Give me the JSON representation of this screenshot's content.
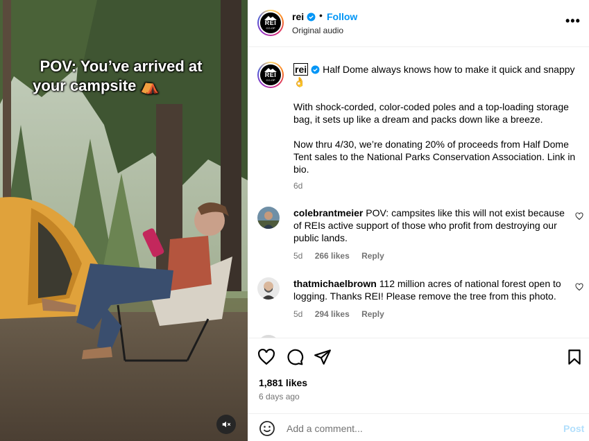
{
  "video": {
    "overlay_line1": "POV: You’ve arrived at",
    "overlay_line2": "your campsite ⛺",
    "mute_icon": "speaker-muted-icon"
  },
  "header": {
    "username": "rei",
    "separator": "•",
    "follow_label": "Follow",
    "audio_label": "Original audio",
    "more_label": "•••",
    "logo_text": "REI",
    "logo_subtext": "CO-OP"
  },
  "caption": {
    "username": "rei",
    "line1": "Half Dome always knows how to make it quick and snappy 👌",
    "para2": "With shock-corded, color-coded poles and a top-loading storage bag, it sets up like a dream and packs down like a breeze.",
    "para3": "Now thru 4/30, we’re donating 20% of proceeds from Half Dome Tent sales to the National Parks Conservation Association. Link in bio.",
    "time": "6d"
  },
  "comments": [
    {
      "username": "colebrantmeier",
      "text": "POV: campsites like this will not exist because of REIs active support of those who profit from destroying our public lands.",
      "time": "5d",
      "likes": "266 likes",
      "reply": "Reply"
    },
    {
      "username": "thatmichaelbrown",
      "text": "112 million acres of national forest open to logging. Thanks REI! Please remove the tree from this photo.",
      "time": "5d",
      "likes": "294 likes",
      "reply": "Reply"
    }
  ],
  "actions": {
    "likes": "1,881 likes",
    "posted": "6 days ago"
  },
  "add_comment": {
    "placeholder": "Add a comment...",
    "post_label": "Post"
  },
  "colors": {
    "follow": "#0095f6",
    "post_disabled": "#b2dffc",
    "secondary_text": "#737373",
    "verified": "#0095f6"
  }
}
